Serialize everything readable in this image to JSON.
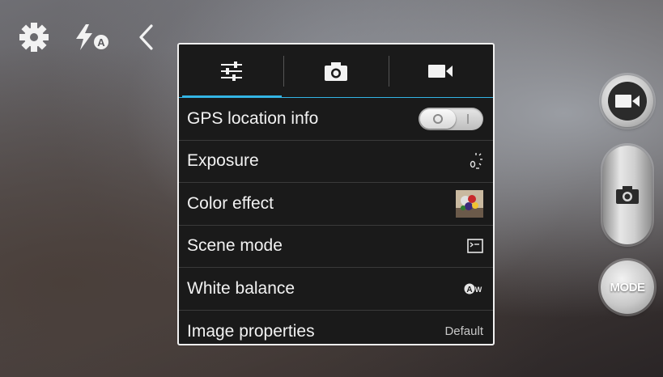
{
  "top_bar": {
    "settings_icon": "gear-icon",
    "flash_icon": "flash-auto-icon",
    "flash_badge": "A",
    "back_icon": "chevron-left-icon"
  },
  "panel": {
    "tabs": [
      {
        "icon": "sliders-icon",
        "active": true
      },
      {
        "icon": "camera-icon",
        "active": false
      },
      {
        "icon": "video-camera-icon",
        "active": false
      }
    ],
    "accent_color": "#33b5e5",
    "rows": [
      {
        "label": "GPS location info",
        "control": "toggle",
        "state": "off"
      },
      {
        "label": "Exposure",
        "control": "icon",
        "icon": "exposure-icon"
      },
      {
        "label": "Color effect",
        "control": "thumbnail",
        "icon": "color-effect-thumbnail"
      },
      {
        "label": "Scene mode",
        "control": "icon",
        "icon": "scene-mode-icon"
      },
      {
        "label": "White balance",
        "control": "icon",
        "icon": "white-balance-auto-icon"
      },
      {
        "label": "Image properties",
        "control": "text",
        "value": "Default"
      }
    ]
  },
  "side_controls": {
    "record_icon": "video-camera-icon",
    "shutter_icon": "camera-icon",
    "mode_label": "MODE"
  }
}
